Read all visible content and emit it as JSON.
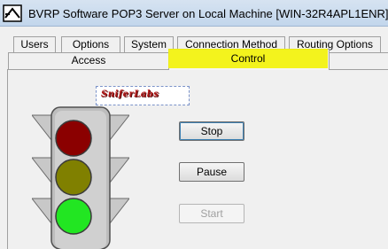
{
  "window": {
    "title": "BVRP Software POP3 Server on Local Machine [WIN-32R4APL1ENR]",
    "icon": "mail-server-icon"
  },
  "tabs": {
    "row1": [
      "Users",
      "Options",
      "System",
      "Connection Method",
      "Routing Options"
    ],
    "row2": [
      "Access",
      "Control"
    ],
    "selected": "Control"
  },
  "logo": {
    "text": "SniferLabs"
  },
  "traffic_light": {
    "lights": [
      {
        "name": "red",
        "state": "off",
        "color": "#8b0000"
      },
      {
        "name": "yellow",
        "state": "off",
        "color": "#808000"
      },
      {
        "name": "green",
        "state": "on",
        "color": "#22e622"
      }
    ]
  },
  "buttons": {
    "stop": {
      "label": "Stop",
      "enabled": true
    },
    "pause": {
      "label": "Pause",
      "enabled": true
    },
    "start": {
      "label": "Start",
      "enabled": false
    }
  },
  "colors": {
    "highlight": "#f2f20a",
    "focus": "#3c7fb1"
  }
}
